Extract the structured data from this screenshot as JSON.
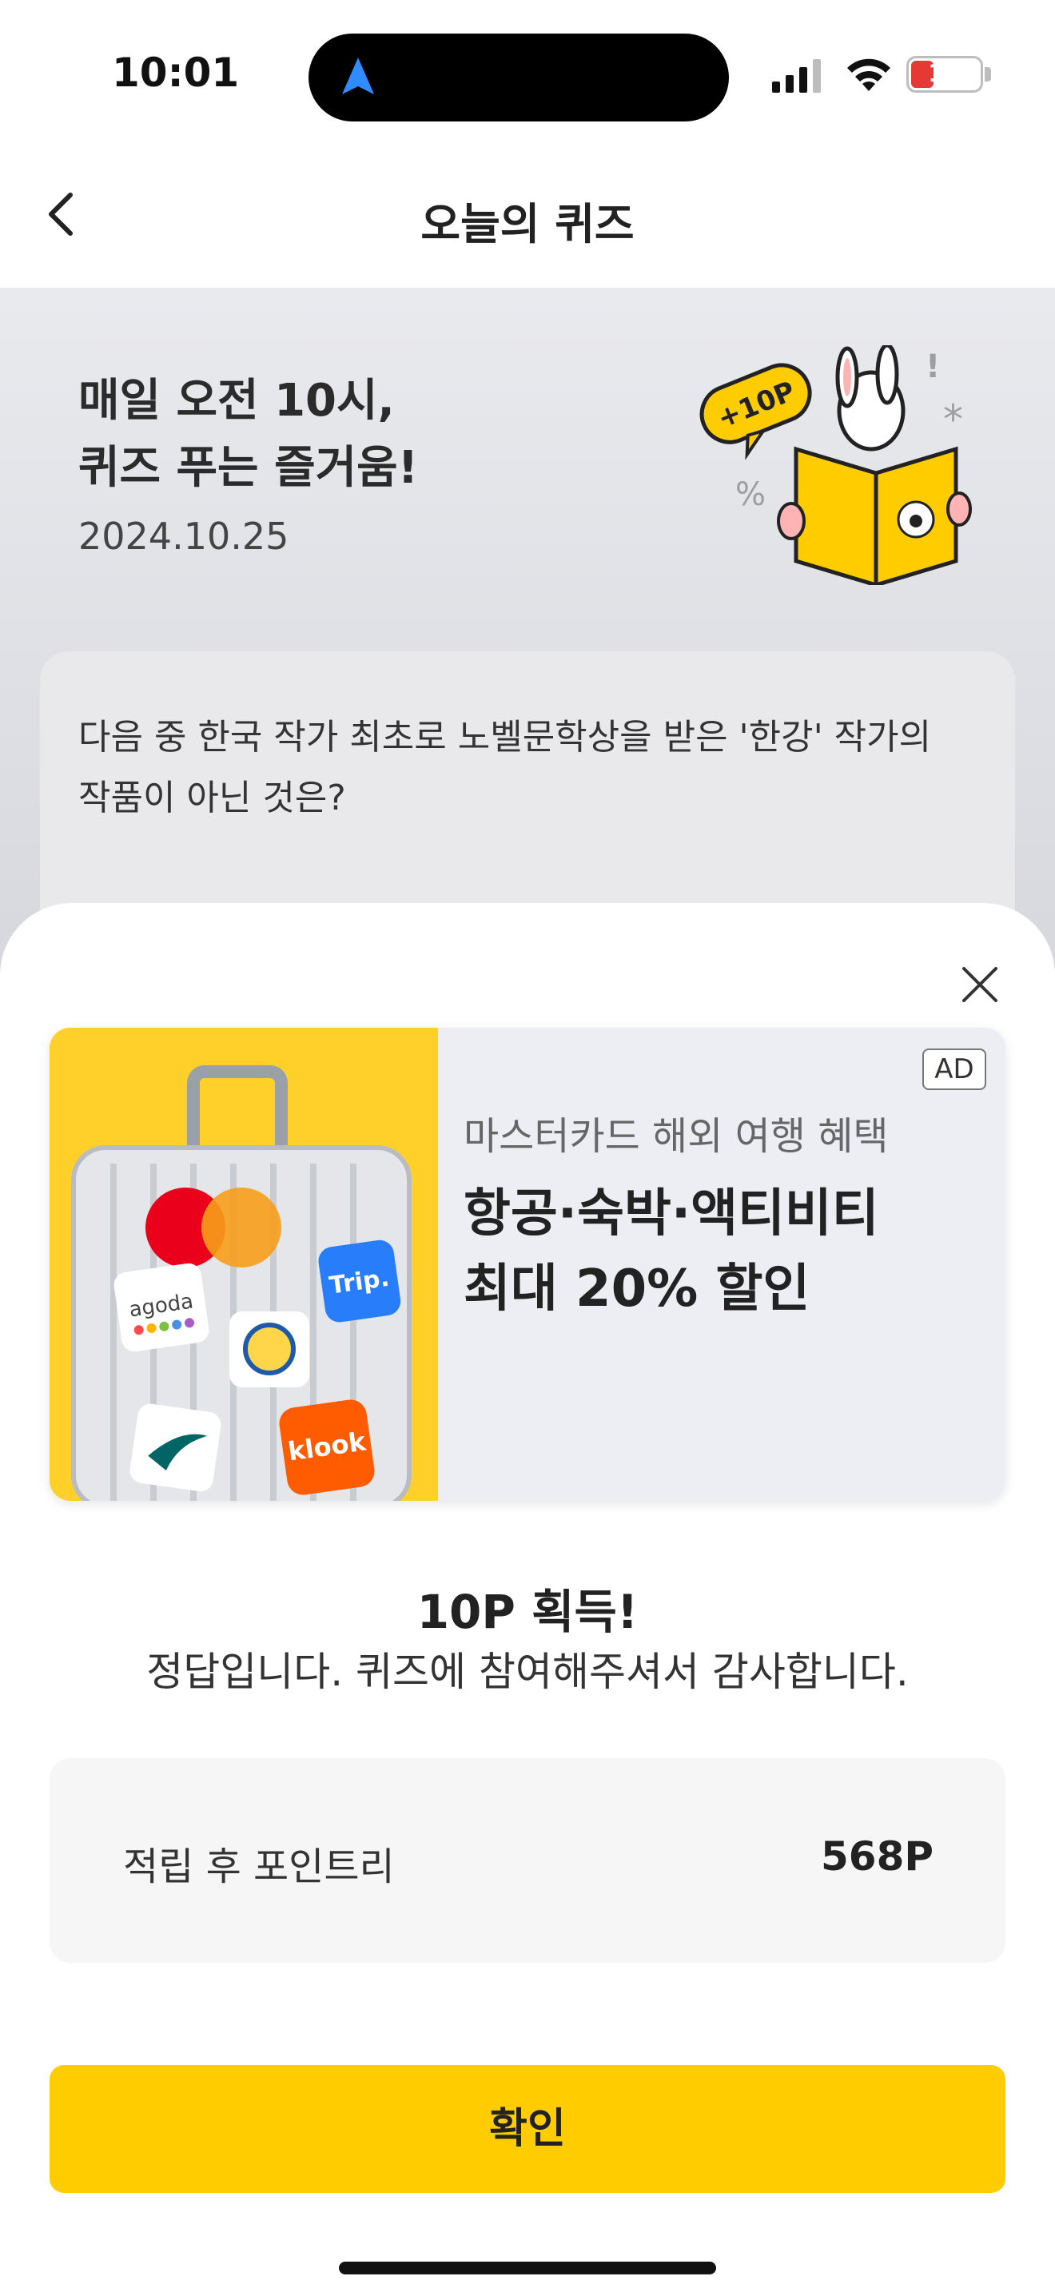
{
  "status_bar": {
    "time": "10:01",
    "battery_level": "13"
  },
  "nav": {
    "title": "오늘의 퀴즈"
  },
  "hero": {
    "title_line1": "매일 오전 10시,",
    "title_line2": "퀴즈 푸는 즐거움!",
    "date": "2024.10.25",
    "badge": "+10P"
  },
  "question": {
    "line1": "다음 중 한국 작가 최초로 노벨문학상을 받은 '한강' 작가의",
    "line2": "작품이 아닌 것은?"
  },
  "ad": {
    "badge": "AD",
    "sub": "마스터카드 해외 여행 혜택",
    "main_line1": "항공·숙박·액티비티",
    "main_line2": "최대 20% 할인",
    "stickers": [
      "agoda",
      "Trip.",
      "klook"
    ]
  },
  "reward": {
    "title": "10P 획득!",
    "message": "정답입니다. 퀴즈에 참여해주셔서 감사합니다."
  },
  "points": {
    "label": "적립 후 포인트리",
    "value": "568P"
  },
  "confirm_label": "확인",
  "colors": {
    "accent": "#ffcc00",
    "ad_bg": "#ffcf2a",
    "sheet_bg": "#ffffff"
  }
}
